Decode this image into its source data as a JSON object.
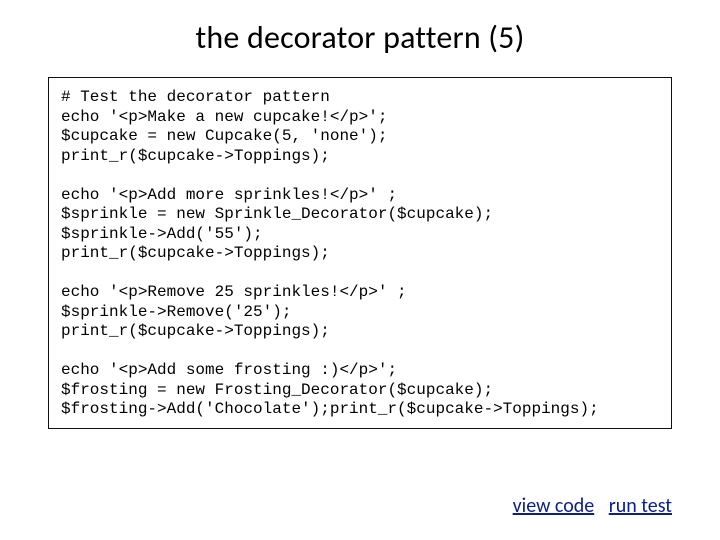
{
  "title": "the decorator pattern (5)",
  "code": "# Test the decorator pattern\necho '<p>Make a new cupcake!</p>';\n$cupcake = new Cupcake(5, 'none');\nprint_r($cupcake->Toppings);\n\necho '<p>Add more sprinkles!</p>' ;\n$sprinkle = new Sprinkle_Decorator($cupcake);\n$sprinkle->Add('55');\nprint_r($cupcake->Toppings);\n\necho '<p>Remove 25 sprinkles!</p>' ;\n$sprinkle->Remove('25');\nprint_r($cupcake->Toppings);\n\necho '<p>Add some frosting :)</p>';\n$frosting = new Frosting_Decorator($cupcake);\n$frosting->Add('Chocolate');print_r($cupcake->Toppings);",
  "links": {
    "view_code": "view code",
    "run_test": "run test"
  }
}
